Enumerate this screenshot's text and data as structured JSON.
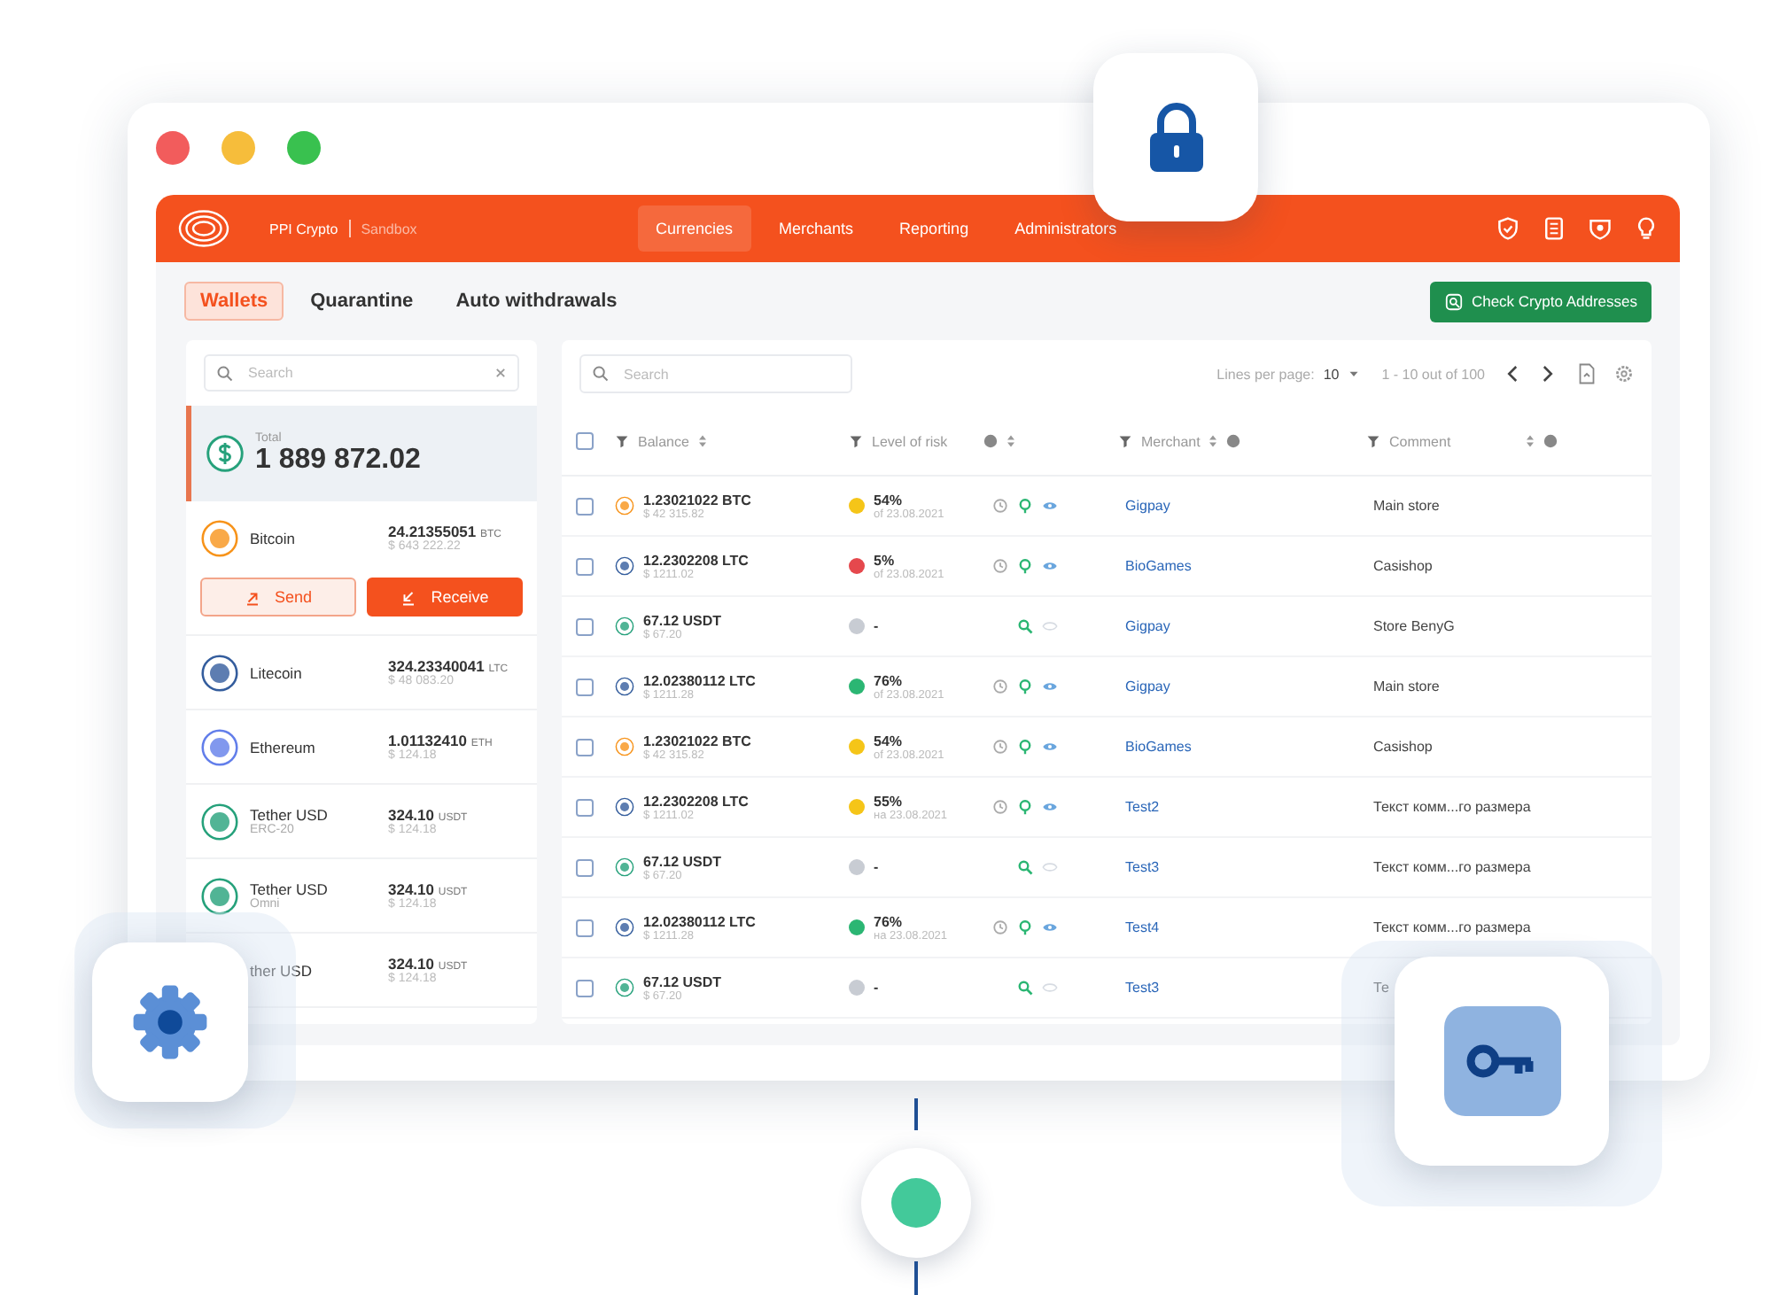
{
  "header": {
    "brand": "PPI Crypto",
    "env": "Sandbox",
    "nav": [
      {
        "label": "Currencies",
        "selected": true
      },
      {
        "label": "Merchants",
        "selected": false
      },
      {
        "label": "Reporting",
        "selected": false
      },
      {
        "label": "Administrators",
        "selected": false
      }
    ]
  },
  "tabs": [
    {
      "label": "Wallets",
      "selected": true
    },
    {
      "label": "Quarantine",
      "selected": false
    },
    {
      "label": "Auto withdrawals",
      "selected": false
    }
  ],
  "check_button": "Check Crypto Addresses",
  "wallets": {
    "search": {
      "placeholder": "Search"
    },
    "total": {
      "label": "Total",
      "value": "1 889 872.02",
      "selected": true
    },
    "send": "Send",
    "receive": "Receive",
    "coins": [
      {
        "kind": "btc",
        "name": "Bitcoin",
        "amount": "24.21355051",
        "unit": "BTC",
        "fiat": "$ 643 222.22",
        "expanded": true
      },
      {
        "kind": "ltc",
        "name": "Litecoin",
        "amount": "324.23340041",
        "unit": "LTC",
        "fiat": "$ 48 083.20",
        "expanded": false
      },
      {
        "kind": "eth",
        "name": "Ethereum",
        "amount": "1.01132410",
        "unit": "ETH",
        "fiat": "$ 124.18",
        "expanded": false
      },
      {
        "kind": "usdt",
        "name": "Tether USD",
        "network": "ERC-20",
        "amount": "324.10",
        "unit": "USDT",
        "fiat": "$ 124.18",
        "expanded": false
      },
      {
        "kind": "usdt",
        "name": "Tether USD",
        "network": "Omni",
        "amount": "324.10",
        "unit": "USDT",
        "fiat": "$ 124.18",
        "expanded": false
      },
      {
        "kind": "partial",
        "name": "ther USD",
        "amount": "324.10",
        "unit": "USDT",
        "fiat": "$ 124.18",
        "expanded": false
      }
    ]
  },
  "table": {
    "search": {
      "placeholder": "Search"
    },
    "pager": {
      "lines_label": "Lines per page:",
      "lines_value": "10",
      "range": "1 - 10 out of 100"
    },
    "select_all_checked": false,
    "columns": [
      "Balance",
      "Level of risk",
      "Merchant",
      "Comment"
    ],
    "rows": [
      {
        "kind": "btc",
        "amount": "1.23021022 BTC",
        "fiat": "$ 42 315.82",
        "risk": "54%",
        "risk_date": "of 23.08.2021",
        "color": "#f5c518",
        "reviewed": true,
        "merchant": "Gigpay",
        "comment": "Main store",
        "checked": false
      },
      {
        "kind": "ltc",
        "amount": "12.2302208 LTC",
        "fiat": "$ 1211.02",
        "risk": "5%",
        "risk_date": "of 23.08.2021",
        "color": "#e5484d",
        "reviewed": true,
        "merchant": "BioGames",
        "comment": "Casishop",
        "checked": false
      },
      {
        "kind": "usdt",
        "amount": "67.12 USDT",
        "fiat": "$ 67.20",
        "risk": "-",
        "color": "#c8ccd3",
        "reviewed": false,
        "merchant": "Gigpay",
        "comment": "Store BenyG",
        "checked": false
      },
      {
        "kind": "ltc",
        "amount": "12.02380112 LTC",
        "fiat": "$ 1211.28",
        "risk": "76%",
        "risk_date": "of 23.08.2021",
        "color": "#2bb673",
        "reviewed": true,
        "merchant": "Gigpay",
        "comment": "Main store",
        "checked": false
      },
      {
        "kind": "btc",
        "amount": "1.23021022 BTC",
        "fiat": "$ 42 315.82",
        "risk": "54%",
        "risk_date": "of 23.08.2021",
        "color": "#f5c518",
        "reviewed": true,
        "merchant": "BioGames",
        "comment": "Casishop",
        "checked": false
      },
      {
        "kind": "ltc",
        "amount": "12.2302208 LTC",
        "fiat": "$ 1211.02",
        "risk": "55%",
        "risk_date": "на 23.08.2021",
        "color": "#f5c518",
        "reviewed": true,
        "merchant": "Test2",
        "comment": "Текст комм...го размера",
        "checked": false
      },
      {
        "kind": "usdt",
        "amount": "67.12 USDT",
        "fiat": "$ 67.20",
        "risk": "-",
        "color": "#c8ccd3",
        "reviewed": false,
        "merchant": "Test3",
        "comment": "Текст комм...го размера",
        "checked": false
      },
      {
        "kind": "ltc",
        "amount": "12.02380112 LTC",
        "fiat": "$ 1211.28",
        "risk": "76%",
        "risk_date": "на 23.08.2021",
        "color": "#2bb673",
        "reviewed": true,
        "merchant": "Test4",
        "comment": "Текст комм...го размера",
        "checked": false
      },
      {
        "kind": "usdt",
        "amount": "67.12 USDT",
        "fiat": "$ 67.20",
        "risk": "-",
        "color": "#c8ccd3",
        "reviewed": false,
        "merchant": "Test3",
        "comment": "Те",
        "checked": false
      }
    ]
  }
}
